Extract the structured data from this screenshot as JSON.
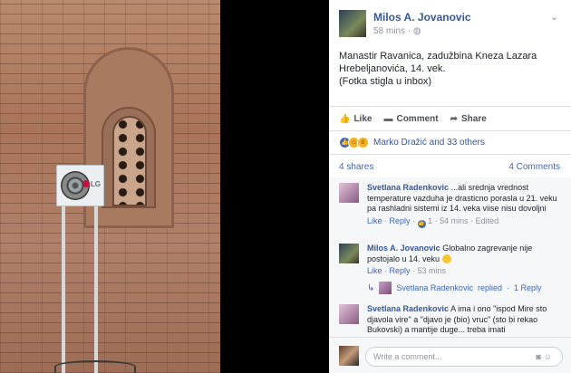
{
  "post": {
    "author": "Milos A. Jovanovic",
    "time": "58 mins",
    "privacy_icon": "globe-icon",
    "text_line1": "Manastir Ravanica, zadužbina Kneza Lazara",
    "text_line2": "Hrebeljanovića, 14. vek.",
    "text_line3": "(Fotka stigla u inbox)",
    "actions": {
      "like": "Like",
      "comment": "Comment",
      "share": "Share"
    },
    "reactions_text": "Marko Dražić and 33 others",
    "shares": "4 shares",
    "comments_count": "4 Comments"
  },
  "photo": {
    "ac_brand": "LG"
  },
  "comments": [
    {
      "name": "Svetlana Radenkovic",
      "text": "...ali srednja vrednost temperature vazduha je drasticno porasla u 21. veku pa rashladni sistemi iz 14. veka viise nisu dovoljni",
      "like": "Like",
      "reply": "Reply",
      "likes": "1",
      "time": "54 mins",
      "edited": "Edited"
    },
    {
      "name": "Milos A. Jovanovic",
      "text": "Globalno zagrevanje nije postojalo u 14. veku",
      "like": "Like",
      "reply": "Reply",
      "time": "53 mins"
    },
    {
      "reply_summary_name": "Svetlana Radenkovic",
      "reply_summary_action": "replied",
      "reply_summary_count": "1 Reply"
    },
    {
      "name": "Svetlana Radenkovic",
      "text": "A ima i ono \"ispod Mire sto djavola vire\" a \"djavo je (bio) vruc\" (sto bi rekao Bukovski) a mantije duge... treba imati"
    }
  ],
  "write_placeholder": "Write a comment...",
  "colors": {
    "link": "#365899",
    "panel_bg": "#ffffff",
    "comments_bg": "#f6f7f9"
  }
}
